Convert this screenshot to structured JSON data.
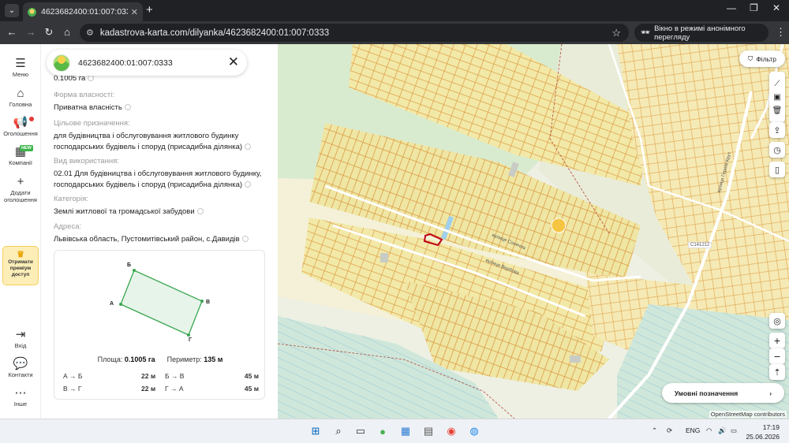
{
  "browser": {
    "tab_title": "4623682400:01:007:0333 | Пуб",
    "tab_close": "✕",
    "new_tab": "+",
    "url": "kadastrova-karta.com/dilyanka/4623682400:01:007:0333",
    "incognito_label": "Вікно в режимі анонімного перегляду"
  },
  "rail": {
    "menu": "Меню",
    "home": "Головна",
    "ads": "Оголошення",
    "companies": "Компанії",
    "new_badge": "NEW",
    "add_ad": "Додати оголошення",
    "premium": "Отримати преміум доступ",
    "login": "Вхід",
    "contacts": "Контакти",
    "other": "Інше"
  },
  "panel": {
    "cadastral_number": "4623682400:01:007:0333",
    "area": "0.1005 га",
    "ownership_label": "Форма власності:",
    "ownership": "Приватна власність",
    "purpose_label": "Цільове призначення:",
    "purpose": "для будівництва і обслуговування житлового будинку господарських будівель і споруд (присадибна ділянка)",
    "use_label": "Вид використання:",
    "use": "02.01 Для будівництва і обслуговування житлового будинку, господарських будівель і споруд (присадибна ділянка)",
    "category_label": "Категорія:",
    "category": "Землі житлової та громадської забудови",
    "address_label": "Адреса:",
    "address": "Львівська область, Пустомитівський район, с.Давидів",
    "vertices": {
      "a": "А",
      "b": "Б",
      "v": "В",
      "g": "Г"
    },
    "area_label": "Площа:",
    "area_value": "0.1005 га",
    "perimeter_label": "Периметр:",
    "perimeter_value": "135 м",
    "sides": [
      {
        "name": "А → Б",
        "value": "22 м"
      },
      {
        "name": "Б → В",
        "value": "45 м"
      },
      {
        "name": "В → Г",
        "value": "22 м"
      },
      {
        "name": "Г → А",
        "value": "45 м"
      }
    ]
  },
  "map": {
    "filter_label": "Фільтр",
    "legend_label": "Умовні позначення",
    "attribution": "OpenStreetMap contributors",
    "road_label_c": "C141212",
    "streets": [
      "вулиця Сонячна",
      "вулиця Вербова",
      "вулиця Героїв Крут"
    ]
  },
  "taskbar": {
    "lang": "ENG",
    "time": "17:19",
    "date": "25.06.2026"
  }
}
